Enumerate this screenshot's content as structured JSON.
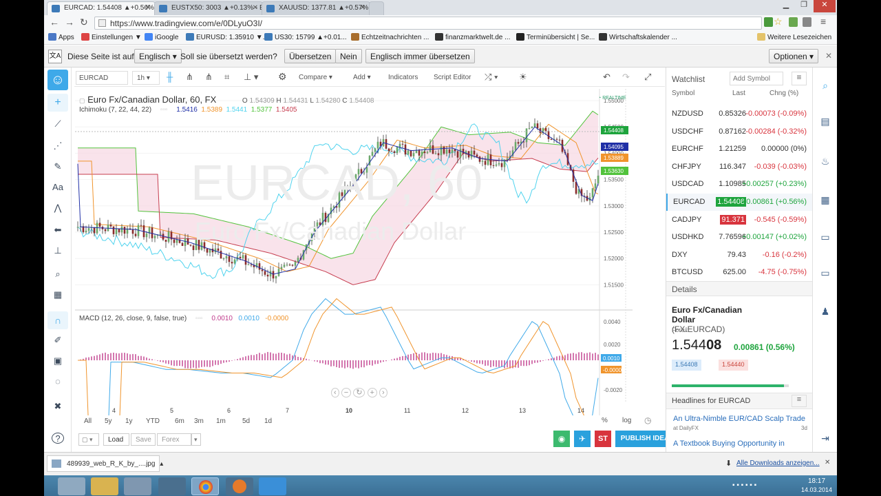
{
  "tabs": [
    {
      "label": "EURCAD: 1.54408 ▲+0.56%",
      "active": true
    },
    {
      "label": "EUSTX50: 3003 ▲+0.13% - Eu",
      "active": false
    },
    {
      "label": "XAUUSD: 1377.81 ▲+0.57%",
      "active": false
    }
  ],
  "address": "https://www.tradingview.com/e/0DLyuO3I/",
  "bookmarks": [
    "Apps",
    "Einstellungen ▼",
    "iGoogle",
    "EURUSD: 1.35910 ▼...",
    "US30: 15799 ▲+0.01...",
    "Echtzeitnachrichten ...",
    "finanzmarktwelt.de ...",
    "Terminübersicht | Se...",
    "Wirtschaftskalender ...",
    "Weitere Lesezeichen"
  ],
  "translate": {
    "text": "Diese Seite ist auf",
    "lang": "Englisch",
    "question": "Soll sie übersetzt werden?",
    "translate": "Übersetzen",
    "no": "Nein",
    "always": "Englisch immer übersetzen",
    "options": "Optionen"
  },
  "toolbar": {
    "symbol": "EURCAD",
    "interval": "1h",
    "compare": "Compare",
    "add": "Add",
    "indicators": "Indicators",
    "script": "Script Editor"
  },
  "legend": {
    "title": "Euro Fx/Canadian Dollar, 60, FX",
    "o_label": "O",
    "o": "1.54309",
    "h_label": "H",
    "h": "1.54431",
    "l_label": "L",
    "l": "1.54280",
    "c_label": "C",
    "c": "1.54408"
  },
  "ichimoku": {
    "label": "Ichimoku (7, 22, 44, 22)",
    "v1": "1.5416",
    "v2": "1.5389",
    "v3": "1.5441",
    "v4": "1.5377",
    "v5": "1.5405"
  },
  "macd": {
    "label": "MACD (12, 26, close, 9, false, true)",
    "v1": "0.0010",
    "v2": "0.0010",
    "v3": "-0.0000"
  },
  "watermark": {
    "big": "EURCAD, 60",
    "sub": "Euro Fx/Canadian Dollar"
  },
  "realtime": "REALTIME",
  "price_axis": [
    "1.55000",
    "1.54500",
    "1.54000",
    "1.53500",
    "1.53000",
    "1.52500",
    "1.52000",
    "1.51500"
  ],
  "price_tags": [
    "1.54408",
    "1.54095",
    "1.53889",
    "1.53630"
  ],
  "macd_axis": [
    "0.0040",
    "0.0020",
    "0.0010",
    "-0.0000",
    "-0.0020"
  ],
  "time_axis": [
    "4",
    "5",
    "6",
    "7",
    "10",
    "11",
    "12",
    "13",
    "14"
  ],
  "ranges": [
    "All",
    "5y",
    "1y",
    "YTD",
    "6m",
    "3m",
    "1m",
    "5d",
    "1d"
  ],
  "bottom_right": [
    "%",
    "log"
  ],
  "save": {
    "load": "Load",
    "save": "Save",
    "forex": "Forex",
    "publish": "PUBLISH IDEA",
    "st": "ST"
  },
  "watchlist": {
    "title": "Watchlist",
    "add_placeholder": "Add Symbol",
    "headers": [
      "Symbol",
      "Last",
      "Chng (%)"
    ],
    "rows": [
      {
        "sym": "NZDUSD",
        "last": "0.85326",
        "chg": "-0.00073 (-0.09%)",
        "dir": "down"
      },
      {
        "sym": "USDCHF",
        "last": "0.87162",
        "chg": "-0.00284 (-0.32%)",
        "dir": "down"
      },
      {
        "sym": "EURCHF",
        "last": "1.21259",
        "chg": "0.00000 (0%)",
        "dir": "flat"
      },
      {
        "sym": "CHFJPY",
        "last": "116.347",
        "chg": "-0.039 (-0.03%)",
        "dir": "down"
      },
      {
        "sym": "USDCAD",
        "last": "1.10985",
        "chg": "+0.00257 (+0.23%)",
        "dir": "up"
      },
      {
        "sym": "EURCAD",
        "last": "1.54408",
        "chg": "+0.00861 (+0.56%)",
        "dir": "up"
      },
      {
        "sym": "CADJPY",
        "last": "91.371",
        "chg": "-0.545 (-0.59%)",
        "dir": "down"
      },
      {
        "sym": "USDHKD",
        "last": "7.76596",
        "chg": "+0.00147 (+0.02%)",
        "dir": "up"
      },
      {
        "sym": "DXY",
        "last": "79.43",
        "chg": "-0.16 (-0.2%)",
        "dir": "down"
      },
      {
        "sym": "BTCUSD",
        "last": "625.00",
        "chg": "-4.75 (-0.75%)",
        "dir": "down"
      }
    ]
  },
  "details": {
    "title": "Details",
    "name": "Euro Fx/Canadian Dollar",
    "code": "(FX:EURCAD)",
    "type": "Forex",
    "price_main": "1.544",
    "price_bold": "08",
    "change": "0.00861 (0.56%)",
    "bid": "1.54408",
    "ask": "1.54440"
  },
  "headlines": {
    "title": "Headlines for EURCAD",
    "items": [
      {
        "text": "An Ultra-Nimble EUR/CAD Scalp Trade",
        "source": "at DailyFX",
        "age": "3d"
      },
      {
        "text": "A Textbook Buying Opportunity in",
        "source": "",
        "age": ""
      }
    ]
  },
  "download": {
    "file": "489939_web_R_K_by_....jpg",
    "all": "Alle Downloads anzeigen..."
  },
  "clock": {
    "time": "18:17",
    "date": "14.03.2014"
  },
  "colors": {
    "green": "#1ea43d",
    "red": "#d8343d",
    "blue": "#2962a8",
    "tenkan": "#1f2fa6",
    "kijun": "#f0942c",
    "chikou": "#4fd3ee",
    "senkouA": "#52c33c",
    "senkouB": "#c63c4e"
  }
}
